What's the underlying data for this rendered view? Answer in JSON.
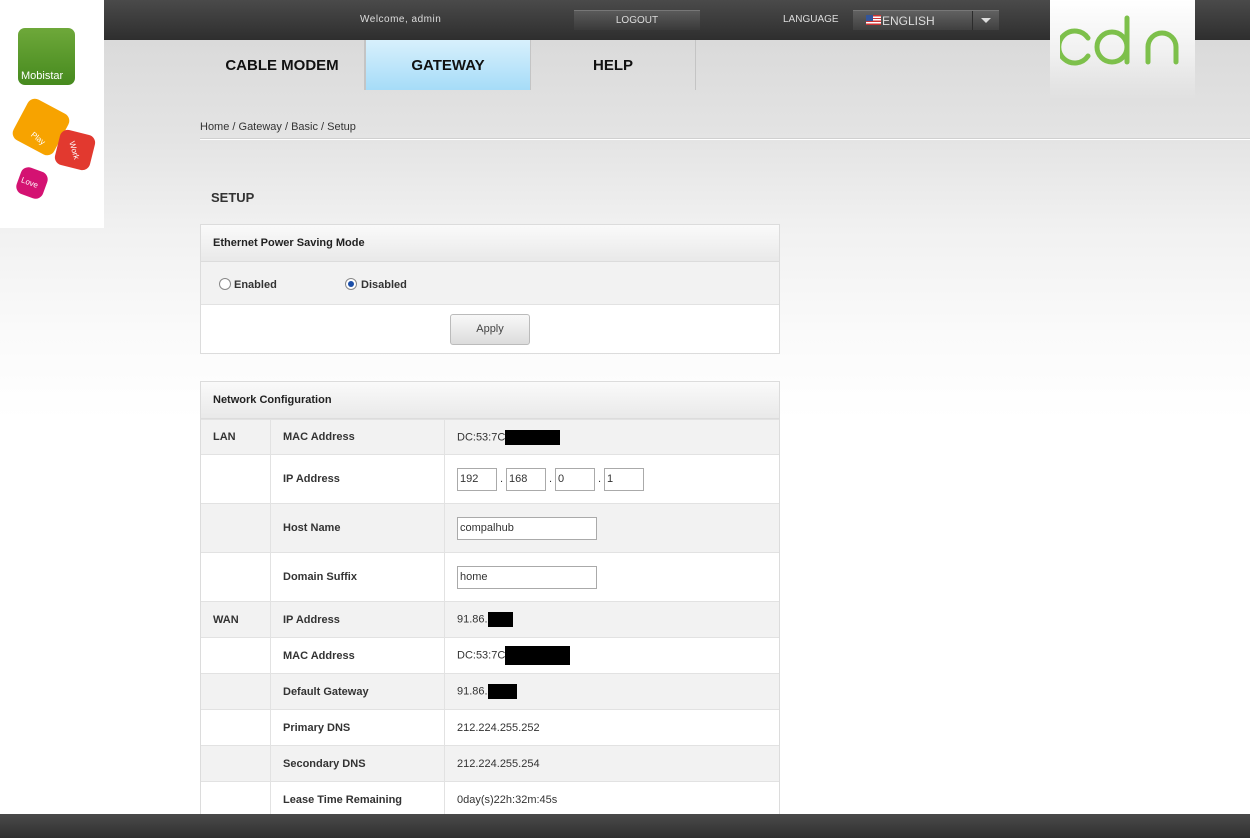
{
  "header": {
    "welcome": "Welcome, admin",
    "logout": "LOGOUT",
    "language_label": "LANGUAGE",
    "language_value": "ENGLISH"
  },
  "branding": {
    "mobistar": "Mobistar",
    "tiles": [
      "Play",
      "Work",
      "Love"
    ],
    "accent_green": "#7dc04b"
  },
  "nav": {
    "items": [
      {
        "label": "CABLE MODEM",
        "active": false
      },
      {
        "label": "GATEWAY",
        "active": true
      },
      {
        "label": "HELP",
        "active": false
      }
    ]
  },
  "breadcrumb": "Home / Gateway / Basic / Setup",
  "page_title": "SETUP",
  "eps": {
    "title": "Ethernet Power Saving Mode",
    "options": [
      "Enabled",
      "Disabled"
    ],
    "selected": "Disabled",
    "apply": "Apply"
  },
  "network": {
    "title": "Network Configuration",
    "lan_label": "LAN",
    "wan_label": "WAN",
    "rows": {
      "lan_mac": {
        "label": "MAC Address",
        "value": "DC:53:7C"
      },
      "lan_ip": {
        "label": "IP Address",
        "octets": [
          "192",
          "168",
          "0",
          "1"
        ]
      },
      "host_name": {
        "label": "Host Name",
        "value": "compalhub"
      },
      "domain_suffix": {
        "label": "Domain Suffix",
        "value": "home"
      },
      "wan_ip": {
        "label": "IP Address",
        "value": "91.86."
      },
      "wan_mac": {
        "label": "MAC Address",
        "value": "DC:53:7C"
      },
      "gateway": {
        "label": "Default Gateway",
        "value": "91.86."
      },
      "primary_dns": {
        "label": "Primary DNS",
        "value": "212.224.255.252"
      },
      "secondary_dns": {
        "label": "Secondary DNS",
        "value": "212.224.255.254"
      },
      "lease": {
        "label": "Lease Time Remaining",
        "value": "0day(s)22h:32m:45s"
      }
    }
  }
}
